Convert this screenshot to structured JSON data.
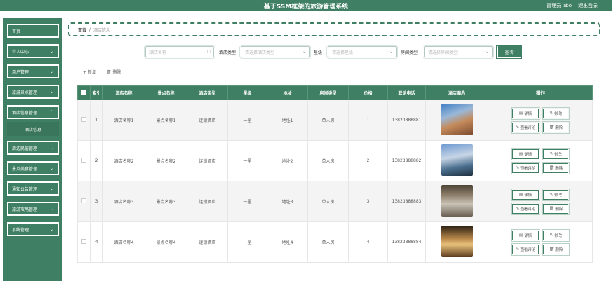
{
  "header": {
    "title": "基于SSM框架的旅游管理系统",
    "user": "管理员 abo",
    "logout": "退出登录"
  },
  "sidebar": {
    "items": [
      {
        "label": "首页",
        "has_children": false
      },
      {
        "label": "个人中心",
        "has_children": true
      },
      {
        "label": "用户管理",
        "has_children": true
      },
      {
        "label": "旅游景点管理",
        "has_children": true
      },
      {
        "label": "酒店信息管理",
        "has_children": true
      },
      {
        "label": "周边民俗管理",
        "has_children": true
      },
      {
        "label": "景点美食管理",
        "has_children": true
      },
      {
        "label": "通知公告管理",
        "has_children": true
      },
      {
        "label": "旅游攻略管理",
        "has_children": true
      },
      {
        "label": "系统管理",
        "has_children": true
      }
    ],
    "active_sub": "酒店信息"
  },
  "breadcrumb": {
    "home": "首页",
    "sep": "/",
    "current": "酒店信息"
  },
  "search": {
    "name_placeholder": "酒店名称",
    "type_label": "酒店类型",
    "type_placeholder": "请选择酒店类型",
    "star_label": "星级",
    "star_placeholder": "请选择星级",
    "room_label": "房间类型",
    "room_placeholder": "请选择房间类型",
    "query": "查询"
  },
  "toolbar": {
    "add": "新增",
    "delete": "删除"
  },
  "table": {
    "headers": [
      "索引",
      "酒店名称",
      "景点名称",
      "酒店类型",
      "星级",
      "地址",
      "房间类型",
      "价格",
      "联系电话",
      "酒店图片",
      "操作"
    ],
    "rows": [
      {
        "index": "1",
        "hotel": "酒店名称1",
        "spot": "景点名称1",
        "type": "连锁酒店",
        "star": "一星",
        "address": "地址1",
        "room": "单人房",
        "price": "1",
        "phone": "13823888881"
      },
      {
        "index": "2",
        "hotel": "酒店名称2",
        "spot": "景点名称2",
        "type": "连锁酒店",
        "star": "一星",
        "address": "地址2",
        "room": "单人房",
        "price": "2",
        "phone": "13823888882"
      },
      {
        "index": "3",
        "hotel": "酒店名称3",
        "spot": "景点名称3",
        "type": "连锁酒店",
        "star": "一星",
        "address": "地址3",
        "room": "单人房",
        "price": "3",
        "phone": "13823888883"
      },
      {
        "index": "4",
        "hotel": "酒店名称4",
        "spot": "景点名称4",
        "type": "连锁酒店",
        "star": "一星",
        "address": "地址4",
        "room": "单人房",
        "price": "4",
        "phone": "13823888884"
      }
    ],
    "buttons": {
      "detail": "详情",
      "edit": "修改",
      "review": "查看评论",
      "delete": "删除"
    }
  },
  "colors": {
    "primary": "#3f7f63"
  }
}
